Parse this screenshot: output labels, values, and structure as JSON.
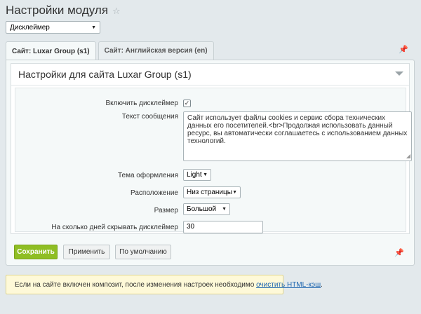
{
  "header": {
    "title": "Настройки модуля"
  },
  "module_select": {
    "value": "Дисклеймер"
  },
  "tabs": [
    {
      "label": "Сайт: Luxar Group (s1)",
      "active": true
    },
    {
      "label": "Сайт: Английская версия (en)",
      "active": false
    }
  ],
  "section": {
    "title": "Настройки для сайта Luxar Group (s1)"
  },
  "form": {
    "enable_label": "Включить дисклеймер",
    "enable_checked": true,
    "message_label": "Текст сообщения",
    "message_value": "Сайт использует файлы cookies и сервис сбора технических данных его посетителей.<br>Продолжая использовать данный ресурс, вы автоматически соглашаетесь с использованием данных технологий.",
    "theme_label": "Тема оформления",
    "theme_value": "Light",
    "position_label": "Расположение",
    "position_value": "Низ страницы",
    "size_label": "Размер",
    "size_value": "Большой",
    "days_label": "На сколько дней скрывать дисклеймер",
    "days_value": "30"
  },
  "buttons": {
    "save": "Сохранить",
    "apply": "Применить",
    "defaults": "По умолчанию"
  },
  "notice": {
    "text": "Если на сайте включен композит, после изменения настроек необходимо ",
    "link": "очистить HTML-кэш",
    "suffix": "."
  }
}
